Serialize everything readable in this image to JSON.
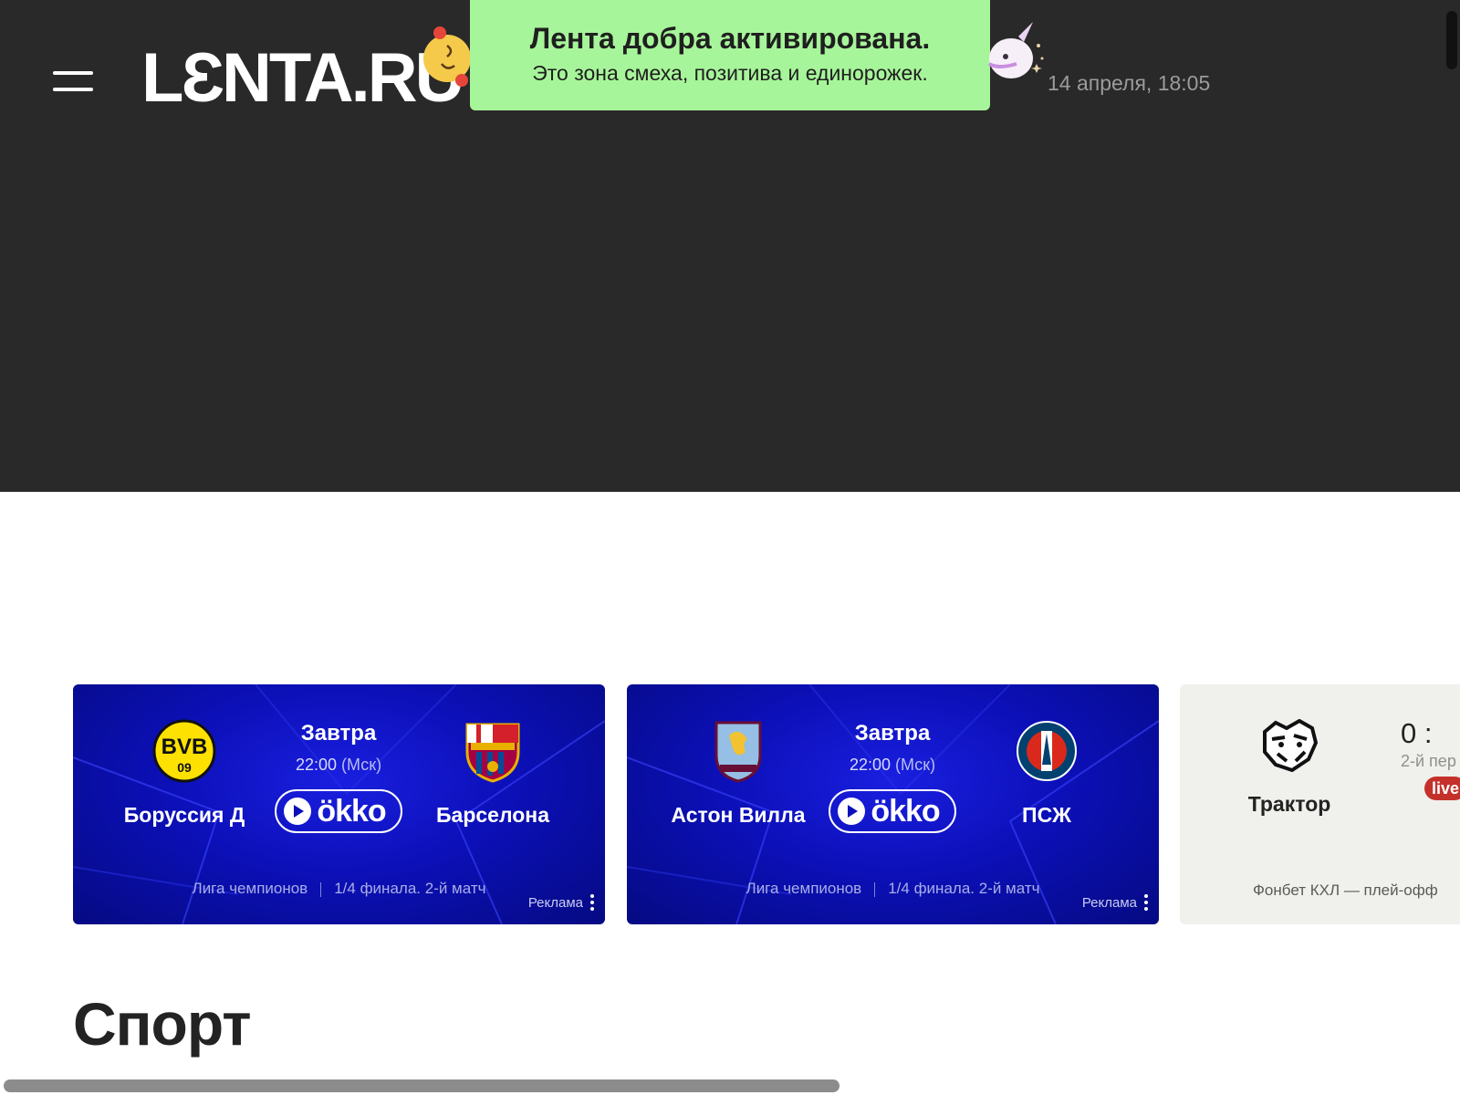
{
  "header": {
    "logo": "LƐNTA.RU",
    "datetime": "14 апреля, 18:05",
    "menu_icon": "hamburger-icon",
    "bg_color": "#292929"
  },
  "toast": {
    "title": "Лента добра активирована.",
    "subtitle": "Это зона смеха, позитива и единорожек.",
    "bg_color": "#a7f59a"
  },
  "matches": [
    {
      "home": "Боруссия Д",
      "away": "Барселона",
      "day": "Завтра",
      "time": "22:00",
      "tz": "(Мск)",
      "broadcaster": "ökko",
      "league": "Лига чемпионов",
      "stage": "1/4 финала. 2-й матч",
      "ad_label": "Реклама"
    },
    {
      "home": "Астон Вилла",
      "away": "ПСЖ",
      "day": "Завтра",
      "time": "22:00",
      "tz": "(Мск)",
      "broadcaster": "ökko",
      "league": "Лига чемпионов",
      "stage": "1/4 финала. 2-й матч",
      "ad_label": "Реклама"
    },
    {
      "home": "Трактор",
      "score": "0 :",
      "period": "2-й пер",
      "status": "live",
      "league": "Фонбет КХЛ — плей-офф"
    }
  ],
  "section": {
    "title": "Спорт"
  },
  "colors": {
    "ucl_blue": "#0c10b8",
    "live_red": "#c4312b",
    "khl_bg": "#f0f1ec"
  }
}
